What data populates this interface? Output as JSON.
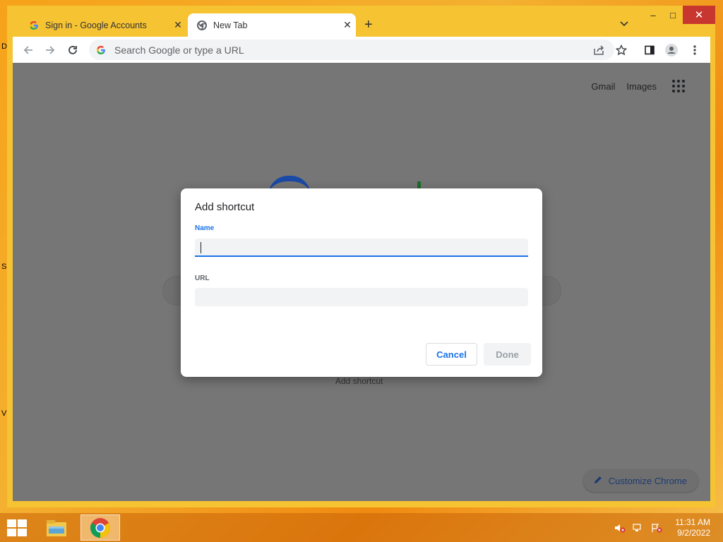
{
  "desktop": {
    "letters": [
      "D",
      "S",
      "V"
    ]
  },
  "window": {
    "controls": {
      "minimize": "–",
      "maximize": "□",
      "close": "✕"
    }
  },
  "tabs": [
    {
      "title": "Sign in - Google Accounts",
      "icon": "google-g-icon",
      "active": false
    },
    {
      "title": "New Tab",
      "icon": "chrome-icon",
      "active": true
    }
  ],
  "toolbar": {
    "omnibox_placeholder": "Search Google or type a URL"
  },
  "ntp": {
    "links": [
      "Gmail",
      "Images"
    ],
    "customize_label": "Customize Chrome",
    "add_shortcut_bg_label": "Add shortcut"
  },
  "dialog": {
    "title": "Add shortcut",
    "name_label": "Name",
    "name_value": "",
    "url_label": "URL",
    "url_value": "",
    "cancel_label": "Cancel",
    "done_label": "Done"
  },
  "taskbar": {
    "time": "11:31 AM",
    "date": "9/2/2022"
  },
  "colors": {
    "accent": "#1a73e8",
    "overlay": "#767676",
    "window_frame": "#f6c333"
  }
}
